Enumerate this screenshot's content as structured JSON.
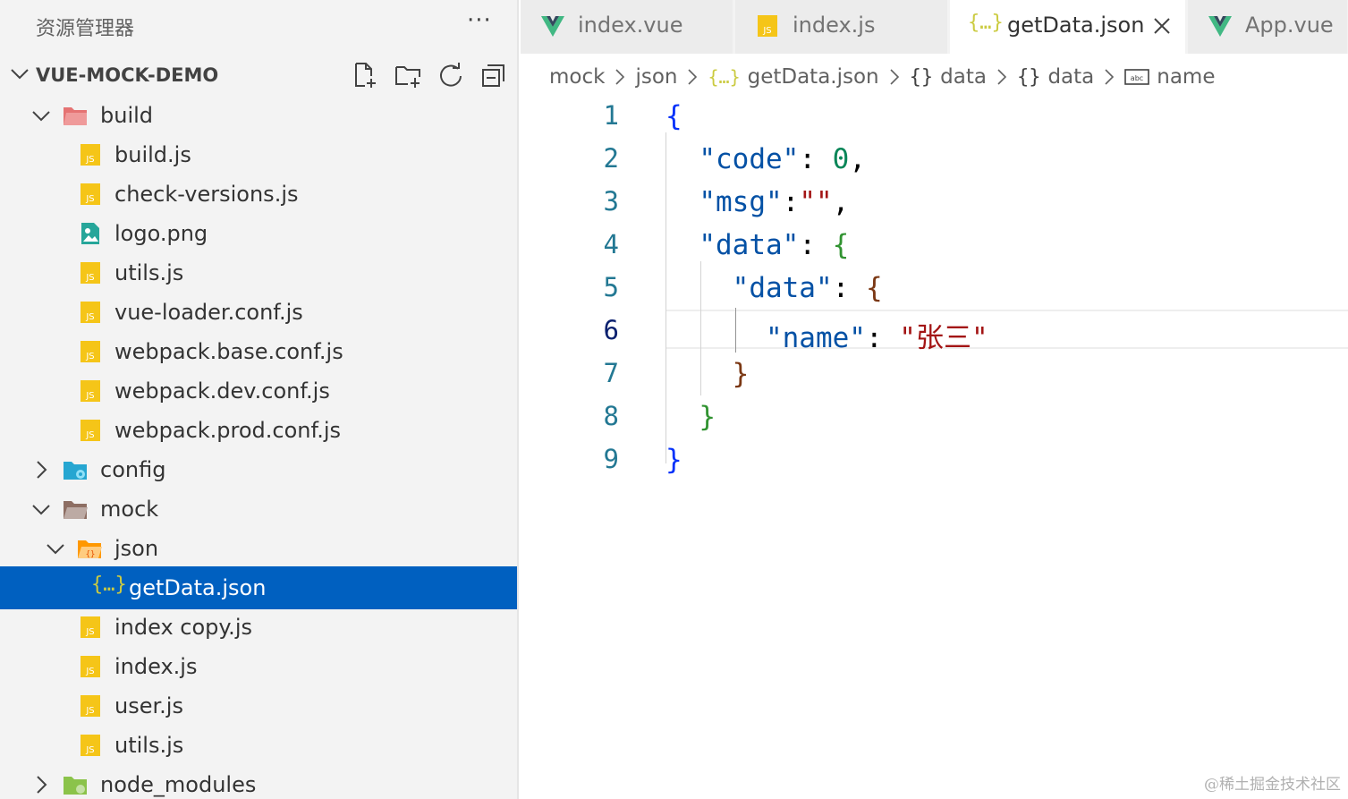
{
  "sidebar": {
    "title": "资源管理器",
    "more": "···",
    "project": {
      "name": "VUE-MOCK-DEMO"
    },
    "items": [
      {
        "label": "build",
        "kind": "folder-build",
        "expanded": true
      },
      {
        "label": "build.js",
        "kind": "js"
      },
      {
        "label": "check-versions.js",
        "kind": "js"
      },
      {
        "label": "logo.png",
        "kind": "image"
      },
      {
        "label": "utils.js",
        "kind": "js"
      },
      {
        "label": "vue-loader.conf.js",
        "kind": "js"
      },
      {
        "label": "webpack.base.conf.js",
        "kind": "js"
      },
      {
        "label": "webpack.dev.conf.js",
        "kind": "js"
      },
      {
        "label": "webpack.prod.conf.js",
        "kind": "js"
      },
      {
        "label": "config",
        "kind": "folder-config",
        "expanded": false
      },
      {
        "label": "mock",
        "kind": "folder-mock",
        "expanded": true
      },
      {
        "label": "json",
        "kind": "folder-json",
        "expanded": true
      },
      {
        "label": "getData.json",
        "kind": "json",
        "selected": true
      },
      {
        "label": "index copy.js",
        "kind": "js"
      },
      {
        "label": "index.js",
        "kind": "js"
      },
      {
        "label": "user.js",
        "kind": "js"
      },
      {
        "label": "utils.js",
        "kind": "js"
      },
      {
        "label": "node_modules",
        "kind": "folder-node",
        "expanded": false
      }
    ]
  },
  "tabs": [
    {
      "label": "index.vue",
      "icon": "vue-icon",
      "active": false
    },
    {
      "label": "index.js",
      "icon": "js-icon",
      "active": false
    },
    {
      "label": "getData.json",
      "icon": "json-icon",
      "active": true
    },
    {
      "label": "App.vue",
      "icon": "vue-icon",
      "active": false
    }
  ],
  "breadcrumb": [
    {
      "label": "mock"
    },
    {
      "label": "json"
    },
    {
      "label": "getData.json",
      "icon": "json-icon"
    },
    {
      "label": "data",
      "icon": "object-icon"
    },
    {
      "label": "data",
      "icon": "object-icon"
    },
    {
      "label": "name",
      "icon": "string-icon"
    }
  ],
  "editor": {
    "line_numbers": [
      "1",
      "2",
      "3",
      "4",
      "5",
      "6",
      "7",
      "8",
      "9"
    ],
    "active_line": "6",
    "code": {
      "l1_open": "{",
      "code_key": "\"code\"",
      "code_val": "0",
      "msg_key": "\"msg\"",
      "msg_val": "\"\"",
      "data_key": "\"data\"",
      "data_open": "{",
      "inner_key": "\"data\"",
      "inner_open": "{",
      "name_key": "\"name\"",
      "name_val": "\"张三\"",
      "inner_close": "}",
      "data_close": "}",
      "l9_close": "}"
    }
  },
  "watermark": "@稀土掘金技术社区",
  "colors": {
    "selection": "#0060c0",
    "js_icon": "#f5c518",
    "vue_icon": "#41b883",
    "json_icon": "#cbcb41"
  }
}
